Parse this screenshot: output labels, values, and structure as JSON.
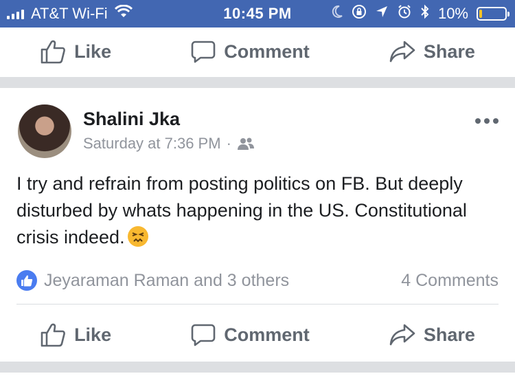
{
  "status": {
    "carrier": "AT&T Wi-Fi",
    "time": "10:45 PM",
    "battery": "10%",
    "battery_level": 0.1,
    "icons": [
      "signal-bars-icon",
      "wifi-icon",
      "moon-icon",
      "rotation-lock-icon",
      "location-arrow-icon",
      "alarm-icon",
      "bluetooth-icon",
      "battery-icon"
    ],
    "accent": "#4267b2"
  },
  "top_actions": {
    "like": "Like",
    "comment": "Comment",
    "share": "Share"
  },
  "post": {
    "author": "Shalini Jka",
    "timestamp": "Saturday at 7:36 PM",
    "separator": "·",
    "audience_icon": "friends-icon",
    "text": "I try and refrain from posting politics on FB. But deeply disturbed by whats happening in the US. Constitutional crisis indeed.",
    "emoji": "persevering-face-emoji",
    "reactions_text": "Jeyaraman Raman and 3 others",
    "comments_count": "4 Comments",
    "actions": {
      "like": "Like",
      "comment": "Comment",
      "share": "Share"
    }
  }
}
